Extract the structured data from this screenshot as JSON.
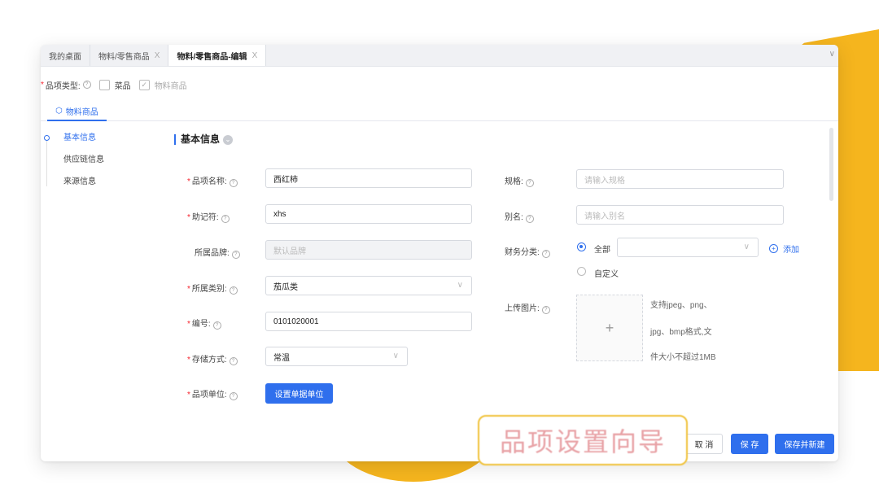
{
  "tabs": [
    {
      "label": "我的桌面",
      "closable": false,
      "active": false
    },
    {
      "label": "物料/零售商品",
      "closable": true,
      "active": false
    },
    {
      "label": "物料/零售商品-编辑",
      "closable": true,
      "active": true
    }
  ],
  "tab_close_glyph": "X",
  "item_type": {
    "label": "品项类型:",
    "options": [
      {
        "label": "菜品",
        "checked": false
      },
      {
        "label": "物料商品",
        "checked": true
      }
    ]
  },
  "subtab": {
    "label": "物料商品"
  },
  "sidenav": [
    "基本信息",
    "供应链信息",
    "来源信息"
  ],
  "section_title": "基本信息",
  "left_fields": {
    "name": {
      "label": "品项名称:",
      "value": "西红柿"
    },
    "mnemonic": {
      "label": "助记符:",
      "value": "xhs"
    },
    "brand": {
      "label": "所属品牌:",
      "placeholder": "默认品牌"
    },
    "category": {
      "label": "所属类别:",
      "value": "茄瓜类"
    },
    "code": {
      "label": "编号:",
      "value": "0101020001"
    },
    "storage": {
      "label": "存储方式:",
      "value": "常温"
    },
    "unit": {
      "label": "品项单位:",
      "button": "设置单据单位"
    }
  },
  "right_fields": {
    "spec": {
      "label": "规格:",
      "placeholder": "请输入规格"
    },
    "alias": {
      "label": "别名:",
      "placeholder": "请输入别名"
    },
    "finance": {
      "label": "财务分类:",
      "option_all": "全部",
      "option_custom": "自定义",
      "add_link": "添加"
    },
    "upload": {
      "label": "上传图片:",
      "hint_1": "支持jpeg、png、",
      "hint_2": "jpg、bmp格式,文",
      "hint_3": "件大小不超过1MB"
    }
  },
  "footer": {
    "cancel": "取 消",
    "save": "保 存",
    "save_new": "保存并新建"
  },
  "overlay_caption": "品项设置向导",
  "colors": {
    "primary": "#2f6fed",
    "accent_bg": "#f5b51e",
    "required": "#f5222d"
  }
}
